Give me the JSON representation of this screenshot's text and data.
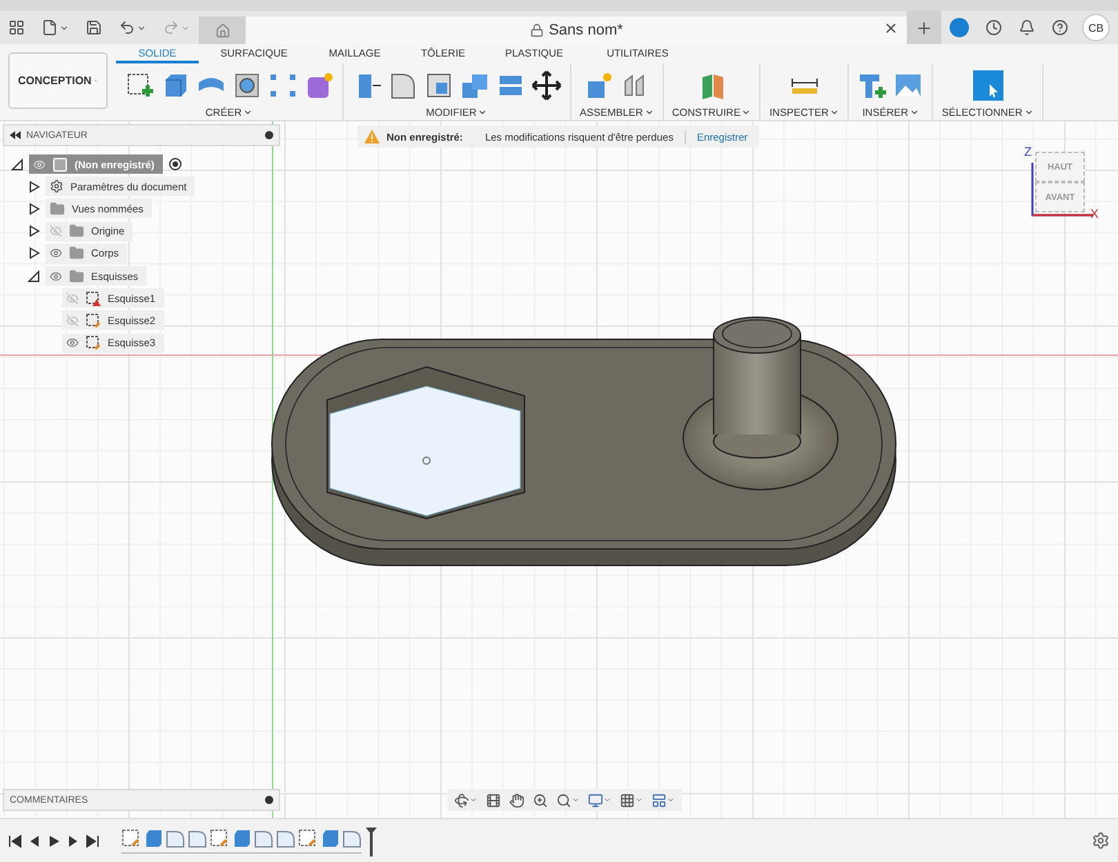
{
  "document_tab": {
    "title": "Sans nom*"
  },
  "user": {
    "initials": "CB"
  },
  "workspace": {
    "label": "CONCEPTION"
  },
  "ribbon_tabs": [
    {
      "label": "SOLIDE",
      "selected": true
    },
    {
      "label": "SURFACIQUE",
      "selected": false
    },
    {
      "label": "MAILLAGE",
      "selected": false
    },
    {
      "label": "TÔLERIE",
      "selected": false
    },
    {
      "label": "PLASTIQUE",
      "selected": false
    },
    {
      "label": "UTILITAIRES",
      "selected": false
    }
  ],
  "ribbon_groups": [
    {
      "label": "CRÉER"
    },
    {
      "label": "MODIFIER"
    },
    {
      "label": "ASSEMBLER"
    },
    {
      "label": "CONSTRUIRE"
    },
    {
      "label": "INSPECTER"
    },
    {
      "label": "INSÉRER"
    },
    {
      "label": "SÉLECTIONNER"
    }
  ],
  "navigator": {
    "title": "NAVIGATEUR",
    "tree": [
      {
        "label": "(Non enregistré)",
        "kind": "root",
        "selected": true,
        "expanded": true,
        "visible": true,
        "children": [
          {
            "label": "Paramètres du document",
            "kind": "settings",
            "selected": false,
            "expanded": false
          },
          {
            "label": "Vues nommées",
            "kind": "folder",
            "selected": false,
            "expanded": false
          },
          {
            "label": "Origine",
            "kind": "folder",
            "selected": false,
            "expanded": false,
            "visible": false
          },
          {
            "label": "Corps",
            "kind": "folder",
            "selected": false,
            "expanded": false,
            "visible": true
          },
          {
            "label": "Esquisses",
            "kind": "folder",
            "selected": false,
            "expanded": true,
            "visible": true,
            "children": [
              {
                "label": "Esquisse1",
                "kind": "sketch_error",
                "selected": false,
                "visible": false
              },
              {
                "label": "Esquisse2",
                "kind": "sketch",
                "selected": false,
                "visible": false
              },
              {
                "label": "Esquisse3",
                "kind": "sketch",
                "selected": false,
                "visible": true
              }
            ]
          }
        ]
      }
    ]
  },
  "banner": {
    "title": "Non enregistré:",
    "message": "Les modifications risquent d'être perdues",
    "action": "Enregistrer"
  },
  "viewcube": {
    "top": "HAUT",
    "front": "AVANT",
    "axis_z": "Z",
    "axis_x": "X"
  },
  "comments": {
    "title": "COMMENTAIRES"
  },
  "timeline": {
    "features": [
      {
        "kind": "sketch"
      },
      {
        "kind": "extrude"
      },
      {
        "kind": "fillet"
      },
      {
        "kind": "fillet"
      },
      {
        "kind": "sketch"
      },
      {
        "kind": "extrude"
      },
      {
        "kind": "fillet"
      },
      {
        "kind": "fillet"
      },
      {
        "kind": "sketch"
      },
      {
        "kind": "extrude"
      },
      {
        "kind": "fillet"
      }
    ]
  }
}
